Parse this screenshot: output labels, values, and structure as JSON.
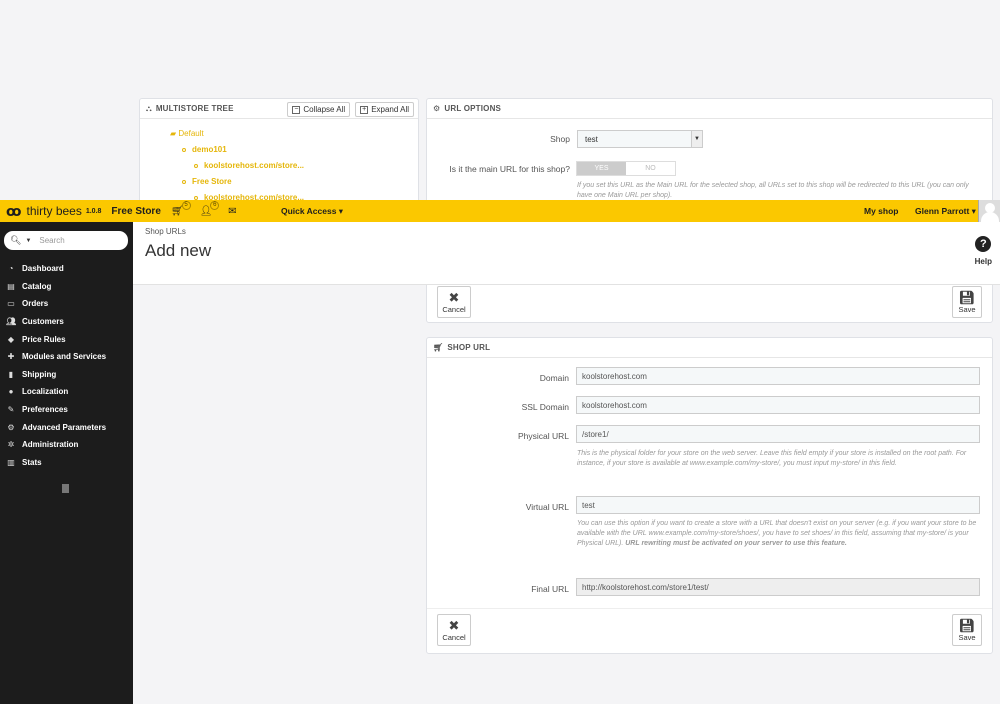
{
  "header": {
    "logo_text": "thirty bees",
    "version": "1.0.8",
    "store_name": "Free Store",
    "cart_badge": "5",
    "user_badge": "6",
    "quick_access": "Quick Access ▾",
    "my_shop": "My shop",
    "employee": "Glenn Parrott ▾"
  },
  "sidebar": {
    "search_placeholder": "Search",
    "items": [
      {
        "label": "Dashboard",
        "icon": "dashboard-icon"
      },
      {
        "label": "Catalog",
        "icon": "catalog-icon"
      },
      {
        "label": "Orders",
        "icon": "orders-icon"
      },
      {
        "label": "Customers",
        "icon": "customers-icon"
      },
      {
        "label": "Price Rules",
        "icon": "price-rules-icon"
      },
      {
        "label": "Modules and Services",
        "icon": "modules-icon"
      },
      {
        "label": "Shipping",
        "icon": "shipping-icon"
      },
      {
        "label": "Localization",
        "icon": "localization-icon"
      },
      {
        "label": "Preferences",
        "icon": "preferences-icon"
      },
      {
        "label": "Advanced Parameters",
        "icon": "advanced-parameters-icon"
      },
      {
        "label": "Administration",
        "icon": "administration-icon"
      },
      {
        "label": "Stats",
        "icon": "stats-icon"
      }
    ]
  },
  "page_head": {
    "breadcrumb": "Shop URLs",
    "title": "Add new",
    "help_label": "Help"
  },
  "tree": {
    "heading": "MULTISTORE TREE",
    "collapse_all": "Collapse All",
    "expand_all": "Expand All",
    "nodes": {
      "root": "Default",
      "shop1": "demo101",
      "shop1_url": "koolstorehost.com/store...",
      "shop2": "Free Store",
      "shop2_url": "koolstorehost.com/store..."
    }
  },
  "url_options": {
    "heading": "URL OPTIONS",
    "shop_label": "Shop",
    "shop_value": "test",
    "main_label": "Is it the main URL for this shop?",
    "yes": "YES",
    "no": "NO",
    "main_help": "If you set this URL as the Main URL for the selected shop, all URLs set to this shop will be redirected to this URL (you can only have one Main URL per shop).",
    "cancel": "Cancel",
    "save": "Save"
  },
  "shop_url": {
    "heading": "SHOP URL",
    "domain_label": "Domain",
    "domain_value": "koolstorehost.com",
    "ssl_label": "SSL Domain",
    "ssl_value": "koolstorehost.com",
    "physical_label": "Physical URL",
    "physical_value": "/store1/",
    "physical_help": "This is the physical folder for your store on the web server. Leave this field empty if your store is installed on the root path. For instance, if your store is available at www.example.com/my-store/, you must input my-store/ in this field.",
    "virtual_label": "Virtual URL",
    "virtual_value": "test",
    "virtual_help": "You can use this option if you want to create a store with a URL that doesn't exist on your server (e.g. if you want your store to be available with the URL www.example.com/my-store/shoes/, you have to set shoes/ in this field, assuming that my-store/ is your Physical URL).",
    "virtual_help_bold": "URL rewriting must be activated on your server to use this feature.",
    "final_label": "Final URL",
    "final_value": "http://koolstorehost.com/store1/test/",
    "cancel": "Cancel",
    "save": "Save"
  }
}
